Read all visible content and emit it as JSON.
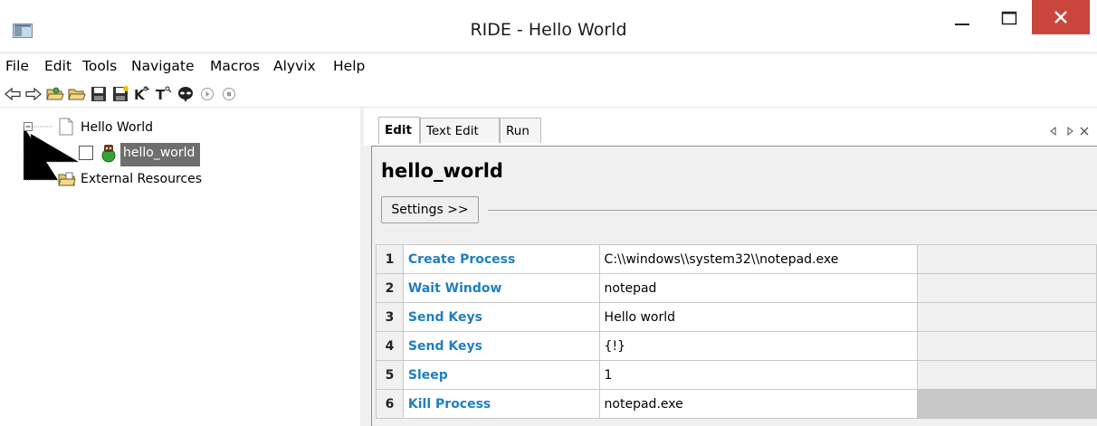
{
  "window": {
    "title": "RIDE - Hello World",
    "close_color": "#c9463d"
  },
  "menu": {
    "items": [
      "File",
      "Edit",
      "Tools",
      "Navigate",
      "Macros",
      "Alyvix",
      "Help"
    ]
  },
  "toolbar": {
    "icons": [
      "back-arrow-icon",
      "forward-arrow-icon",
      "open-directory-icon",
      "open-folder-icon",
      "save-icon",
      "save-all-icon",
      "search-keywords-icon",
      "search-tests-icon",
      "alyvix-alien-icon",
      "run-icon",
      "stop-icon"
    ]
  },
  "tree": {
    "project": "Hello World",
    "testcase": "hello_world",
    "external": "External Resources"
  },
  "tabs": {
    "edit": "Edit",
    "text_edit": "Text Edit",
    "run": "Run"
  },
  "editor": {
    "title": "hello_world",
    "settings_button": "Settings >>"
  },
  "steps": [
    {
      "num": "1",
      "keyword": "Create Process",
      "arg": "C:\\\\windows\\\\system32\\\\notepad.exe"
    },
    {
      "num": "2",
      "keyword": "Wait Window",
      "arg": "notepad"
    },
    {
      "num": "3",
      "keyword": "Send Keys",
      "arg": "Hello world"
    },
    {
      "num": "4",
      "keyword": "Send Keys",
      "arg": "{!}"
    },
    {
      "num": "5",
      "keyword": "Sleep",
      "arg": "1"
    },
    {
      "num": "6",
      "keyword": "Kill Process",
      "arg": "notepad.exe"
    }
  ],
  "colors": {
    "keyword": "#1f7fc1",
    "selection": "#6e6e6e"
  }
}
